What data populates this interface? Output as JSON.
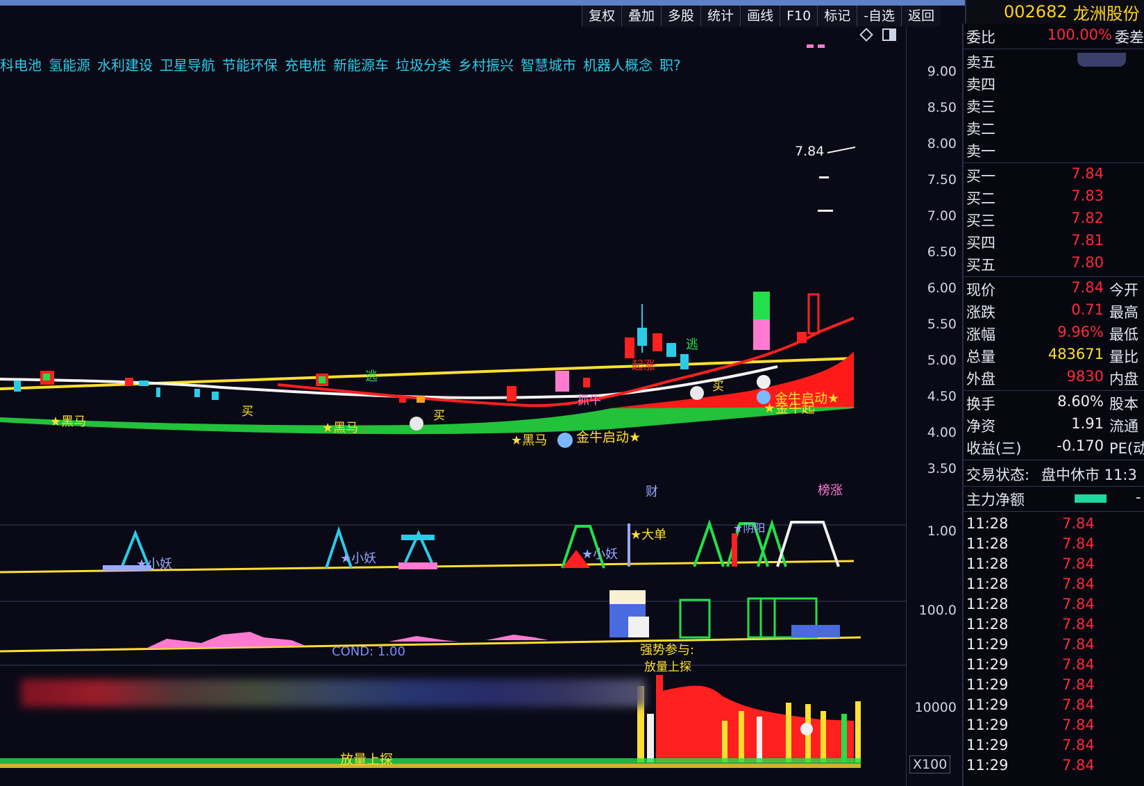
{
  "toolbar": {
    "items": [
      "复权",
      "叠加",
      "多股",
      "统计",
      "画线",
      "F10",
      "标记",
      "-自选",
      "返回"
    ]
  },
  "stock": {
    "code": "002682",
    "name": "龙洲股份"
  },
  "concepts": [
    "科电池",
    "氢能源",
    "水利建设",
    "卫星导航",
    "节能环保",
    "充电桩",
    "新能源车",
    "垃圾分类",
    "乡村振兴",
    "智慧城市",
    "机器人概念",
    "职?"
  ],
  "price_axis": [
    "9.00",
    "8.50",
    "8.00",
    "7.50",
    "7.00",
    "6.50",
    "6.00",
    "5.50",
    "5.00",
    "4.50",
    "4.00",
    "3.50"
  ],
  "ind1_axis": "1.00",
  "ind2_axis": "100.0",
  "ind3_axis": "10000",
  "x100": "X100",
  "last_price_label": "7.84",
  "annotations": {
    "heima": "★黑马",
    "buy": "买",
    "escape": "逃",
    "jinniu_start": "金牛启动★",
    "jinniu_start2": "金牛启动★",
    "jinniu_qi": "★金牛起",
    "zhuaniu": "抓牛",
    "qizhang": "起涨",
    "xiaoyao": "★小妖",
    "dadan": "★大单",
    "yang": "★阴阳",
    "cai": "财",
    "zhangting": "榜涨",
    "fangliang": "放量上探",
    "qiangshi": "强势参与:",
    "shangtan": "放量上探",
    "cond": "COND: 1.00"
  },
  "order_book": {
    "weibi": {
      "label": "委比",
      "value": "100.00%",
      "right": "委差"
    },
    "sell": [
      {
        "label": "卖五",
        "price": ""
      },
      {
        "label": "卖四",
        "price": ""
      },
      {
        "label": "卖三",
        "price": ""
      },
      {
        "label": "卖二",
        "price": ""
      },
      {
        "label": "卖一",
        "price": ""
      }
    ],
    "buy": [
      {
        "label": "买一",
        "price": "7.84"
      },
      {
        "label": "买二",
        "price": "7.83"
      },
      {
        "label": "买三",
        "price": "7.82"
      },
      {
        "label": "买四",
        "price": "7.81"
      },
      {
        "label": "买五",
        "price": "7.80"
      }
    ]
  },
  "quote": [
    {
      "label": "现价",
      "value": "7.84",
      "color": "#ff2a3a",
      "right": "今开"
    },
    {
      "label": "涨跌",
      "value": "0.71",
      "color": "#ff2a3a",
      "right": "最高"
    },
    {
      "label": "涨幅",
      "value": "9.96%",
      "color": "#ff2a3a",
      "right": "最低"
    },
    {
      "label": "总量",
      "value": "483671",
      "color": "#ffe030",
      "right": "量比"
    },
    {
      "label": "外盘",
      "value": "9830",
      "color": "#ff2a3a",
      "right": "内盘"
    },
    {
      "label": "换手",
      "value": "8.60%",
      "color": "#f0f0f0",
      "right": "股本"
    },
    {
      "label": "净资",
      "value": "1.91",
      "color": "#f0f0f0",
      "right": "流通"
    },
    {
      "label": "收益(三)",
      "value": "-0.170",
      "color": "#f0f0f0",
      "right": "PE(动"
    }
  ],
  "status": {
    "label": "交易状态:",
    "value": "盘中休市 11:3"
  },
  "main_force": {
    "label": "主力净额",
    "right": "-"
  },
  "ticks": [
    {
      "time": "11:28",
      "price": "7.84"
    },
    {
      "time": "11:28",
      "price": "7.84"
    },
    {
      "time": "11:28",
      "price": "7.84"
    },
    {
      "time": "11:28",
      "price": "7.84"
    },
    {
      "time": "11:28",
      "price": "7.84"
    },
    {
      "time": "11:28",
      "price": "7.84"
    },
    {
      "time": "11:29",
      "price": "7.84"
    },
    {
      "time": "11:29",
      "price": "7.84"
    },
    {
      "time": "11:29",
      "price": "7.84"
    },
    {
      "time": "11:29",
      "price": "7.84"
    },
    {
      "time": "11:29",
      "price": "7.84"
    },
    {
      "time": "11:29",
      "price": "7.84"
    },
    {
      "time": "11:29",
      "price": "7.84"
    }
  ],
  "colors": {
    "red": "#ff2a3a",
    "green": "#22e04a",
    "yellow": "#ffe030",
    "cyan": "#2bcbe8",
    "bg": "#0a0a16"
  }
}
